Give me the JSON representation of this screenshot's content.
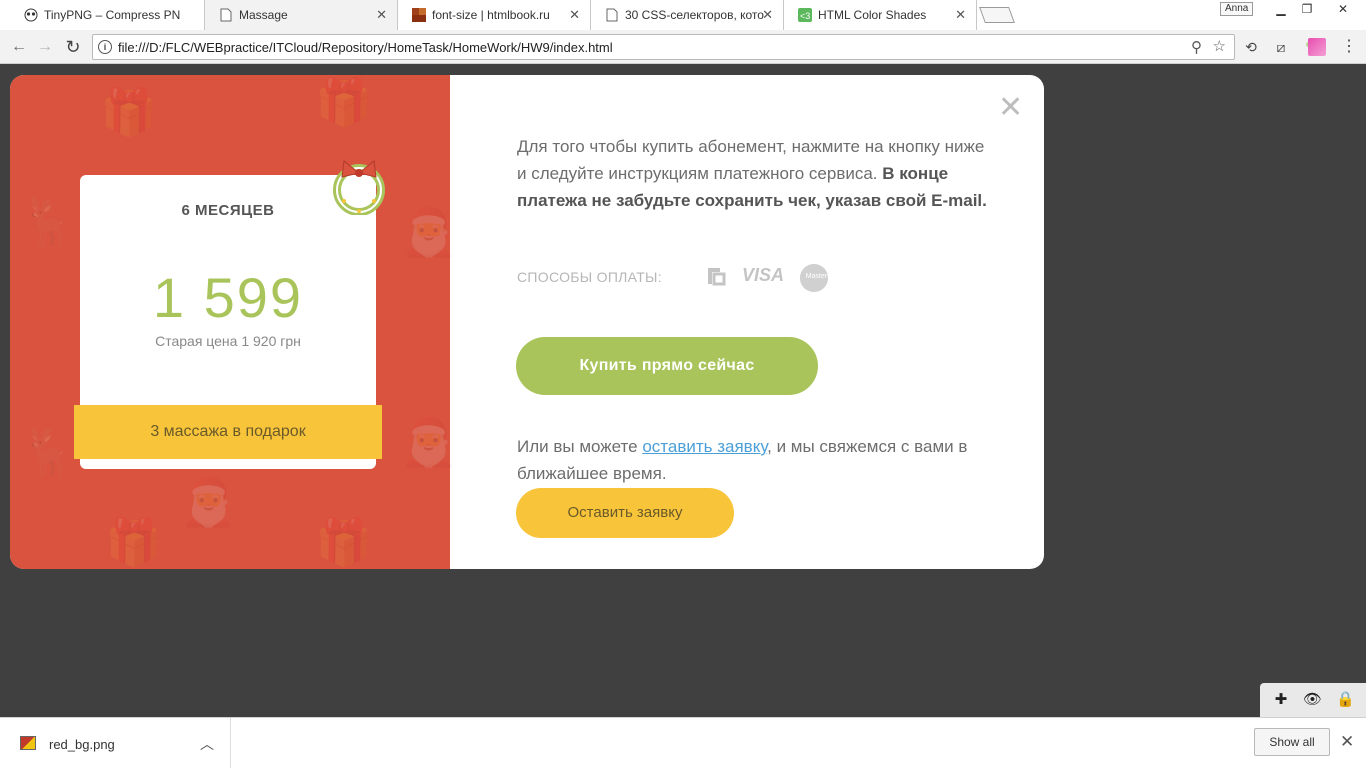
{
  "browser": {
    "tabs": [
      {
        "title": "TinyPNG – Compress PN",
        "icon": "panda-icon",
        "active": false
      },
      {
        "title": "Massage",
        "icon": "page-icon",
        "active": true
      },
      {
        "title": "font-size | htmlbook.ru",
        "icon": "htmlbook-icon",
        "active": false
      },
      {
        "title": "30 CSS-селекторов, кото",
        "icon": "page-icon",
        "active": false
      },
      {
        "title": "HTML Color Shades",
        "icon": "color-shades-icon",
        "active": false
      }
    ],
    "profile_name": "Anna",
    "url": "file:///D:/FLC/WEBpractice/ITCloud/Repository/HomeTask/HomeWork/HW9/index.html"
  },
  "modal": {
    "card": {
      "title": "6 МЕСЯЦЕВ",
      "price": "1 599",
      "old_price": "Старая цена 1 920 грн",
      "gift": "3 массажа в подарок"
    },
    "info_text_plain": "Для того чтобы купить абонемент, нажмите на кнопку ниже и следуйте инструкциям платежного сервиса.",
    "info_text_bold": "В конце платежа не забудьте сохранить чек, указав свой E-mail.",
    "payment_label": "СПОСОБЫ ОПЛАТЫ:",
    "payment_methods": [
      "ПриватБанк",
      "VISA",
      "MasterCard"
    ],
    "buy_button": "Купить прямо сейчас",
    "alt_text_before": "Или вы можете",
    "alt_text_link": "оставить заявку",
    "alt_text_after": ", и мы свяжемся с вами в ближайшее время.",
    "request_button": "Оставить заявку"
  },
  "downloads": {
    "file_name": "red_bg.png",
    "show_all": "Show all"
  },
  "colors": {
    "red_panel": "#d9533f",
    "green_accent": "#a9c45a",
    "yellow_accent": "#f8c43a",
    "link_blue": "#4b9fd8"
  }
}
